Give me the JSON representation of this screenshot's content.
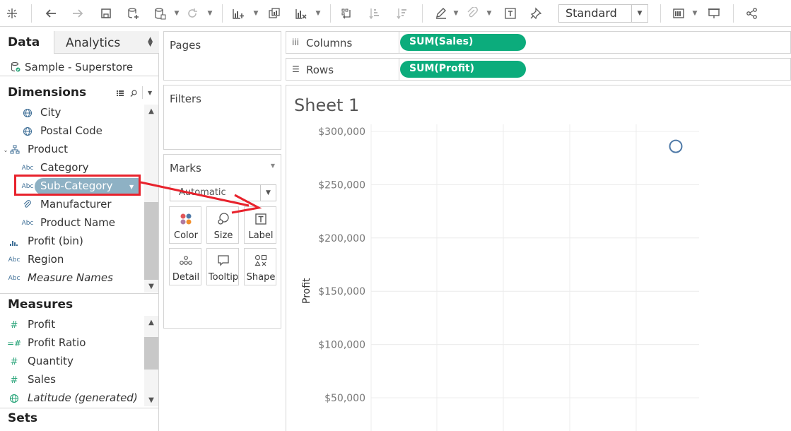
{
  "toolbar": {
    "view_mode": "Standard",
    "icons": [
      "tableau-logo-icon",
      "undo-icon",
      "redo-icon",
      "save-icon",
      "new-data-source-icon",
      "pause-updates-icon",
      "refresh-icon",
      "new-worksheet-icon",
      "duplicate-sheet-icon",
      "clear-sheet-icon",
      "swap-rows-columns-icon",
      "sort-ascending-icon",
      "sort-descending-icon",
      "highlight-icon",
      "group-icon",
      "text-label-icon",
      "pin-icon",
      "show-cards-icon",
      "presentation-icon",
      "share-icon"
    ]
  },
  "data_pane": {
    "tabs": {
      "data": "Data",
      "analytics": "Analytics"
    },
    "datasource": "Sample - Superstore",
    "dimensions_label": "Dimensions",
    "dimensions": [
      {
        "name": "City",
        "icon": "globe-icon"
      },
      {
        "name": "Postal Code",
        "icon": "globe-icon"
      },
      {
        "name": "Product",
        "icon": "hierarchy-icon"
      },
      {
        "name": "Category",
        "icon": "Abc"
      },
      {
        "name": "Sub-Category",
        "icon": "Abc"
      },
      {
        "name": "Manufacturer",
        "icon": "paperclip-icon"
      },
      {
        "name": "Product Name",
        "icon": "Abc"
      },
      {
        "name": "Profit (bin)",
        "icon": "bin-bar-icon"
      },
      {
        "name": "Region",
        "icon": "Abc"
      },
      {
        "name": "Measure Names",
        "icon": "Abc"
      }
    ],
    "measures_label": "Measures",
    "measures": [
      {
        "name": "Profit",
        "icon": "#"
      },
      {
        "name": "Profit Ratio",
        "icon": "=#"
      },
      {
        "name": "Quantity",
        "icon": "#"
      },
      {
        "name": "Sales",
        "icon": "#"
      },
      {
        "name": "Latitude (generated)",
        "icon": "globe-icon"
      }
    ],
    "sets_label": "Sets"
  },
  "cards": {
    "pages": "Pages",
    "filters": "Filters",
    "marks": "Marks",
    "mark_type": "Automatic",
    "buttons": {
      "color": "Color",
      "size": "Size",
      "label": "Label",
      "detail": "Detail",
      "tooltip": "Tooltip",
      "shape": "Shape"
    }
  },
  "shelves": {
    "columns_label": "Columns",
    "columns_pill": "SUM(Sales)",
    "rows_label": "Rows",
    "rows_pill": "SUM(Profit)"
  },
  "sheet": {
    "title": "Sheet 1"
  },
  "chart_data": {
    "type": "scatter",
    "ylabel": "Profit",
    "xlabel": "",
    "y_ticks": [
      "$300,000",
      "$250,000",
      "$200,000",
      "$150,000",
      "$100,000",
      "$50,000"
    ],
    "y_tick_values": [
      300000,
      250000,
      200000,
      150000,
      100000,
      50000
    ],
    "ylim": [
      40000,
      305000
    ],
    "points": [
      {
        "y": 286000
      }
    ],
    "grid": true,
    "colors": {
      "point": "#4e79a7"
    }
  },
  "colors": {
    "pill_green": "#0cac7c",
    "selected_field": "#8eb1c4",
    "highlight_red": "#e8222c"
  }
}
